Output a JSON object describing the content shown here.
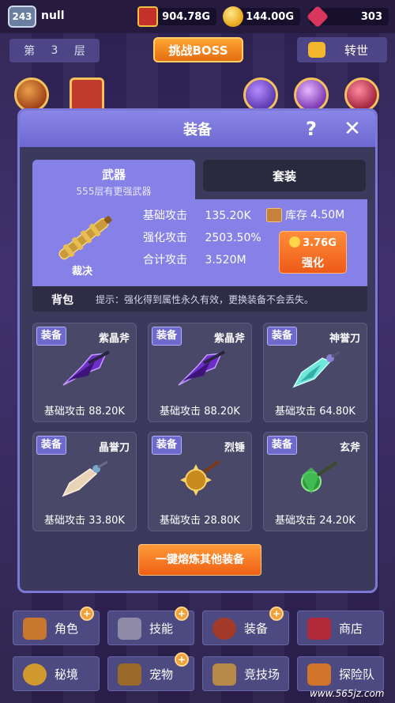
{
  "top": {
    "level": "243",
    "player_name": "null",
    "cash": "904.78G",
    "gold": "144.00G",
    "gems": "303",
    "floor_prefix": "第",
    "floor_number": "3",
    "floor_suffix": "层",
    "boss_button": "挑战BOSS",
    "rebirth_button": "转世"
  },
  "modal": {
    "title": "装备",
    "help": "?",
    "close": "✕",
    "tabs": {
      "weapon": "武器",
      "weapon_sub": "555层有更强武器",
      "set": "套装"
    },
    "weapon": {
      "name": "裁决",
      "stats": [
        {
          "label": "基础攻击",
          "value": "135.20K"
        },
        {
          "label": "强化攻击",
          "value": "2503.50%"
        },
        {
          "label": "合计攻击",
          "value": "3.520M"
        }
      ],
      "stock_label": "库存",
      "stock_value": "4.50M",
      "upgrade_cost": "3.76G",
      "upgrade_label": "强化"
    },
    "bag": {
      "title": "背包",
      "hint": "提示：强化得到属性永久有效，更换装备不会丢失。"
    },
    "items": [
      {
        "name": "紫晶斧",
        "atk_label": "基础攻击",
        "atk": "88.20K",
        "equip": "装备",
        "color": "#7a3fd6"
      },
      {
        "name": "紫晶斧",
        "atk_label": "基础攻击",
        "atk": "88.20K",
        "equip": "装备",
        "color": "#7a3fd6"
      },
      {
        "name": "神誉刀",
        "atk_label": "基础攻击",
        "atk": "64.80K",
        "equip": "装备",
        "color": "#5fd9d0"
      },
      {
        "name": "晶誉刀",
        "atk_label": "基础攻击",
        "atk": "33.80K",
        "equip": "装备",
        "color": "#e0c8a8"
      },
      {
        "name": "烈锤",
        "atk_label": "基础攻击",
        "atk": "28.80K",
        "equip": "装备",
        "color": "#d09a2a"
      },
      {
        "name": "玄斧",
        "atk_label": "基础攻击",
        "atk": "24.20K",
        "equip": "装备",
        "color": "#3cab45"
      }
    ],
    "smelt_button": "一键熔炼其他装备"
  },
  "nav": [
    {
      "label": "角色",
      "icon": "character-icon",
      "plus": true
    },
    {
      "label": "技能",
      "icon": "skill-book-icon",
      "plus": true
    },
    {
      "label": "装备",
      "icon": "equipment-shield-icon",
      "plus": true
    },
    {
      "label": "商店",
      "icon": "shop-chest-icon",
      "plus": false
    },
    {
      "label": "秘境",
      "icon": "secret-realm-icon",
      "plus": false
    },
    {
      "label": "宠物",
      "icon": "pet-icon",
      "plus": true
    },
    {
      "label": "竞技场",
      "icon": "arena-swords-icon",
      "plus": false
    },
    {
      "label": "探险队",
      "icon": "expedition-icon",
      "plus": false
    }
  ],
  "watermark": "www.565jz.com"
}
